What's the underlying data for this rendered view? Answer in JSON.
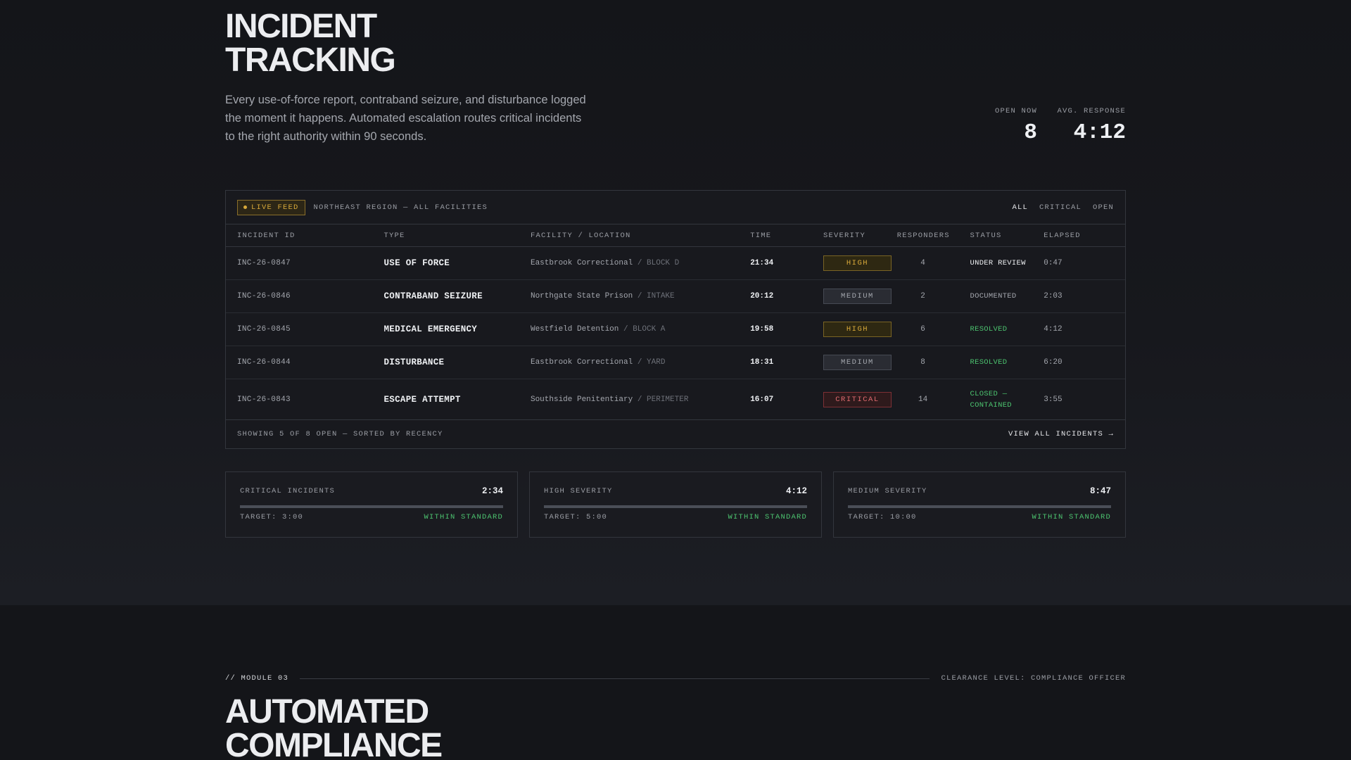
{
  "header": {
    "title": "INCIDENT TRACKING",
    "intro": "Every use-of-force report, contraband seizure, and disturbance logged the moment it happens. Automated escalation routes critical incidents to the right authority within 90 seconds."
  },
  "kpis": {
    "open_label": "OPEN NOW",
    "open_value": "8",
    "avg_label": "AVG. RESPONSE",
    "avg_value": "4:12"
  },
  "feed": {
    "badge": "LIVE FEED",
    "region": "NORTHEAST REGION — ALL FACILITIES",
    "filters": [
      "ALL",
      "CRITICAL",
      "OPEN"
    ],
    "active_filter": "ALL",
    "columns": [
      "INCIDENT ID",
      "TYPE",
      "FACILITY / LOCATION",
      "TIME",
      "SEVERITY",
      "RESPONDERS",
      "STATUS",
      "ELAPSED"
    ],
    "rows": [
      {
        "id": "INC-26-0847",
        "type": "USE OF FORCE",
        "facility": "Eastbrook Correctional",
        "location": "/ BLOCK D",
        "time": "21:34",
        "severity": "HIGH",
        "responders": "4",
        "status": "UNDER REVIEW",
        "elapsed": "0:47"
      },
      {
        "id": "INC-26-0846",
        "type": "CONTRABAND SEIZURE",
        "facility": "Northgate State Prison",
        "location": "/ INTAKE",
        "time": "20:12",
        "severity": "MEDIUM",
        "responders": "2",
        "status": "DOCUMENTED",
        "elapsed": "2:03"
      },
      {
        "id": "INC-26-0845",
        "type": "MEDICAL EMERGENCY",
        "facility": "Westfield Detention",
        "location": "/ BLOCK A",
        "time": "19:58",
        "severity": "HIGH",
        "responders": "6",
        "status": "RESOLVED",
        "elapsed": "4:12"
      },
      {
        "id": "INC-26-0844",
        "type": "DISTURBANCE",
        "facility": "Eastbrook Correctional",
        "location": "/ YARD",
        "time": "18:31",
        "severity": "MEDIUM",
        "responders": "8",
        "status": "RESOLVED",
        "elapsed": "6:20"
      },
      {
        "id": "INC-26-0843",
        "type": "ESCAPE ATTEMPT",
        "facility": "Southside Penitentiary",
        "location": "/ PERIMETER",
        "time": "16:07",
        "severity": "CRITICAL",
        "responders": "14",
        "status_line1": "CLOSED —",
        "status_line2": "CONTAINED",
        "elapsed": "3:55"
      }
    ],
    "footer_note": "SHOWING 5 OF 8 OPEN — SORTED BY RECENCY",
    "view_all": "VIEW ALL INCIDENTS →"
  },
  "sla_cards": [
    {
      "label": "CRITICAL INCIDENTS",
      "value": "2:34",
      "target": "TARGET: 3:00",
      "status": "WITHIN STANDARD",
      "progress": 1.0
    },
    {
      "label": "HIGH SEVERITY",
      "value": "4:12",
      "target": "TARGET: 5:00",
      "status": "WITHIN STANDARD",
      "progress": 1.0
    },
    {
      "label": "MEDIUM SEVERITY",
      "value": "8:47",
      "target": "TARGET: 10:00",
      "status": "WITHIN STANDARD",
      "progress": 1.0
    }
  ],
  "next_module": {
    "tag": "// MODULE 03",
    "clearance": "CLEARANCE LEVEL: COMPLIANCE OFFICER",
    "title": "AUTOMATED COMPLIANCE"
  },
  "colors": {
    "accent_amber": "#d8a93a",
    "critical_red": "#e06a6f",
    "success_green": "#4cc36f",
    "background": "#16171b"
  }
}
